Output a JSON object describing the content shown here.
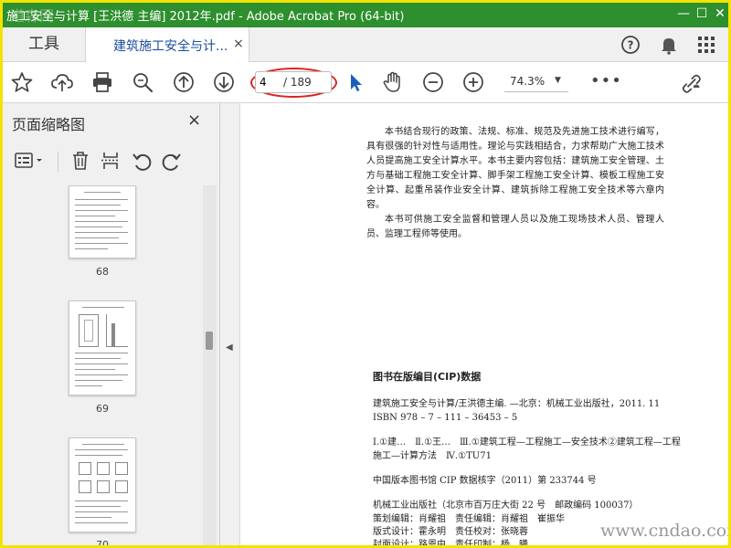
{
  "window": {
    "title": "施工安全与计算 [王洪德 主编] 2012年.pdf - Adobe Acrobat Pro (64-bit)",
    "watermark_tl": "道森网"
  },
  "tabs": {
    "tools_label": "工具",
    "doc_label": "建筑施工安全与计...",
    "close_glyph": "×"
  },
  "toolbar": {
    "page_current": "4",
    "page_total": "/ 189",
    "zoom": "74.3%",
    "more": "•••"
  },
  "sidebar": {
    "title": "页面缩略图",
    "close_glyph": "×",
    "thumbs": [
      {
        "num": "68"
      },
      {
        "num": "69"
      },
      {
        "num": "70"
      }
    ]
  },
  "document": {
    "paragraphs": [
      "本书结合现行的政策、法规、标准、规范及先进施工技术进行编写，具有很强的针对性与适用性。理论与实践相结合，力求帮助广大施工技术人员提高施工安全计算水平。本书主要内容包括：建筑施工安全管理、土方与基础工程施工安全计算、脚手架工程施工安全计算、模板工程施工安全计算、起重吊装作业安全计算、建筑拆除工程施工安全技术等六章内容。",
      "本书可供施工安全监督和管理人员以及施工现场技术人员、管理人员、监理工程师等使用。"
    ],
    "cip_title": "图书在版编目(CIP)数据",
    "cip_line1": "建筑施工安全与计算/王洪德主编. —北京：机械工业出版社，2011. 11",
    "cip_line2": "ISBN 978 – 7 – 111 – 36453 – 5",
    "cip_line3": "Ⅰ.①建…　Ⅱ.①王…　Ⅲ.①建筑工程—工程施工—安全技术②建筑工程—工程施工—计算方法　Ⅳ.①TU71",
    "cip_line4": "中国版本图书馆 CIP 数据核字（2011）第 233744 号",
    "cip_line5": "机械工业出版社（北京市百万庄大街 22 号　邮政编码 100037）",
    "cip_line6": "策划编辑：肖耀祖　责任编辑：肖耀祖　崔振华",
    "cip_line7": "版式设计：霍永明　责任校对：张晓蓉",
    "cip_line8": "封面设计：路恩中　责任印制：杨　曦"
  },
  "watermark_br": "www.cndao.com",
  "colors": {
    "titlebar": "#2d8f2d",
    "accent": "#1a4f9c",
    "highlight": "#e02020",
    "border": "#f2e400"
  }
}
